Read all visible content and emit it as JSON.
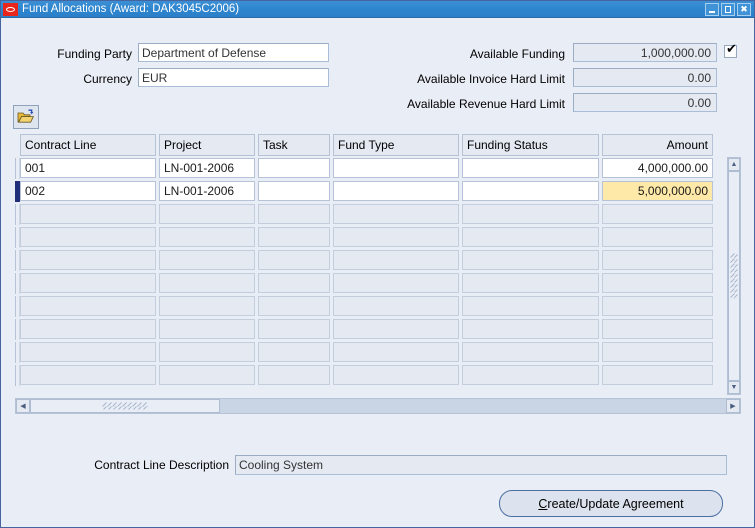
{
  "window": {
    "title": "Fund Allocations (Award: DAK3045C2006)",
    "logo_icon": "oracle-logo",
    "minimize_icon": "minimize-icon",
    "maximize_icon": "maximize-icon",
    "close_icon": "close-icon",
    "close_glyph": "✖"
  },
  "form": {
    "funding_party_label": "Funding Party",
    "funding_party_value": "Department of Defense",
    "currency_label": "Currency",
    "currency_value": "EUR",
    "available_funding_label": "Available Funding",
    "available_funding_value": "1,000,000.00",
    "available_funding_checked": "✔",
    "available_invoice_hard_limit_label": "Available Invoice Hard Limit",
    "available_invoice_hard_limit_value": "0.00",
    "available_revenue_hard_limit_label": "Available Revenue Hard Limit",
    "available_revenue_hard_limit_value": "0.00"
  },
  "toolbar": {
    "folder_icon": "open-folder-icon"
  },
  "grid": {
    "columns": [
      {
        "label": "Contract Line",
        "align": "left"
      },
      {
        "label": "Project",
        "align": "left"
      },
      {
        "label": "Task",
        "align": "left"
      },
      {
        "label": "Fund Type",
        "align": "left"
      },
      {
        "label": "Funding Status",
        "align": "left"
      },
      {
        "label": "Amount",
        "align": "right"
      }
    ],
    "rows": [
      {
        "current": false,
        "contract_line": "001",
        "project": "LN-001-2006",
        "task": "",
        "fund_type": "",
        "funding_status": "",
        "amount": "4,000,000.00",
        "amount_selected": false
      },
      {
        "current": true,
        "contract_line": "002",
        "project": "LN-001-2006",
        "task": "",
        "fund_type": "",
        "funding_status": "",
        "amount": "5,000,000.00",
        "amount_selected": true
      }
    ],
    "empty_row_count": 8,
    "scroll_up_glyph": "▲",
    "scroll_down_glyph": "▼",
    "scroll_left_glyph": "◀",
    "scroll_right_glyph": "▶"
  },
  "footer": {
    "description_label": "Contract Line Description",
    "description_value": "Cooling System",
    "agreement_button_mnemonic": "C",
    "agreement_button_rest": "reate/Update Agreement"
  },
  "colors": {
    "titlebar": "#2e86cf",
    "oracle_red": "#e8261c",
    "body": "#e9edf5",
    "field_readonly": "#e4e9f2",
    "selected_cell": "#ffe9a8",
    "current_record": "#1f2d7a",
    "border": "#b6c3d6"
  }
}
